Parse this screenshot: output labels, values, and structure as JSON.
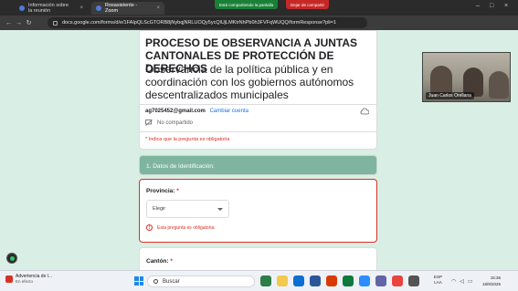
{
  "browser": {
    "tabs": [
      {
        "label": "Información sobre la reunión",
        "active": false
      },
      {
        "label": "Rosasistente - Zoom",
        "active": true
      }
    ],
    "share_banner": "Está compartiendo la pantalla",
    "stop_share": "Dejar de compartir",
    "url": "docs.google.com/forms/d/e/1FAIpQLScGTORB8jNybqjNRLUOQy5ycQlUjLMKtrNhPb0h3FVFqWUQQ/formResponse?pli=1"
  },
  "form": {
    "title": "PROCESO DE OBSERVANCIA A JUNTAS CANTONALES DE PROTECCIÓN DE DERECHOS",
    "description": "Observancia de la política pública y en coordinación con los gobiernos autónomos descentralizados municipales",
    "account_email": "ag7025452@gmail.com",
    "switch_account": "Cambiar cuenta",
    "not_shared": "No compartido",
    "required_note": "* Indica que la pregunta es obligatoria",
    "section_title": "1. Datos de Identificación:",
    "q1": {
      "label": "Provincia:",
      "required_mark": "*",
      "select_value": "Elegir",
      "error": "Esta pregunta es obligatoria."
    },
    "q2": {
      "label": "Cantón:",
      "required_mark": "*"
    }
  },
  "zoom": {
    "participant_name": "Juan Carlos Orellana"
  },
  "taskbar": {
    "notification_title": "Advertencia de l...",
    "notification_subtitle": "En efecto",
    "search_placeholder": "Buscar",
    "lang_top": "ESP",
    "lang_bottom": "LAA",
    "time": "15:36",
    "date": "18/9/2025"
  },
  "colors": {
    "accent": "#7fb5a0",
    "error": "#d93025",
    "link": "#1a73e8",
    "page_bg": "#d9efe6"
  }
}
